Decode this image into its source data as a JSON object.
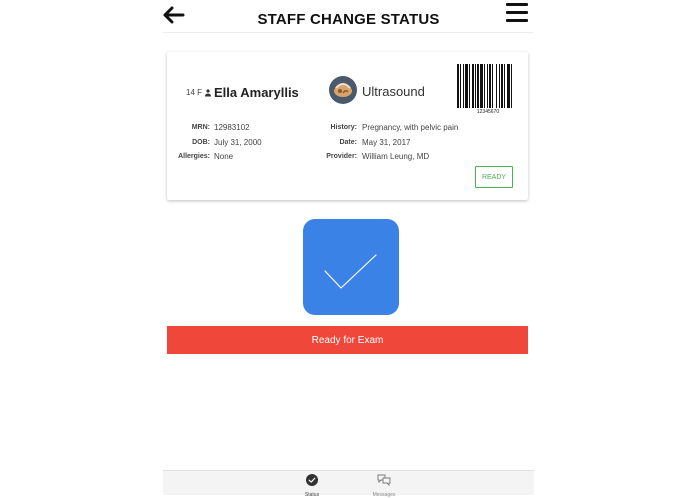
{
  "header": {
    "title": "STAFF CHANGE STATUS",
    "back_icon": "arrow-left-icon",
    "menu_icon": "hamburger-menu-icon"
  },
  "card": {
    "patient": {
      "age_sex": "14 F",
      "name": "Ella Amaryllis"
    },
    "modality": {
      "name": "Ultrasound",
      "icon": "ultrasound-icon"
    },
    "barcode_number": "12345670",
    "fields_left": [
      {
        "label": "MRN:",
        "value": "12983102"
      },
      {
        "label": "DOB:",
        "value": "July 31, 2000"
      },
      {
        "label": "Allergies:",
        "value": "None"
      }
    ],
    "fields_right": [
      {
        "label": "History:",
        "value": "Pregnancy, with pelvic pain"
      },
      {
        "label": "Date:",
        "value": "May 31, 2017"
      },
      {
        "label": "Provider:",
        "value": "William Leung, MD"
      }
    ],
    "badge": "READY"
  },
  "status": {
    "button_label": "Ready for Exam",
    "tile_color": "#3b82e6",
    "bar_color": "#f0473b",
    "badge_color": "#4caf50"
  },
  "tabs": [
    {
      "label": "Status",
      "icon": "checkmark-circle-icon"
    },
    {
      "label": "Messages",
      "icon": "chat-bubbles-icon"
    }
  ]
}
